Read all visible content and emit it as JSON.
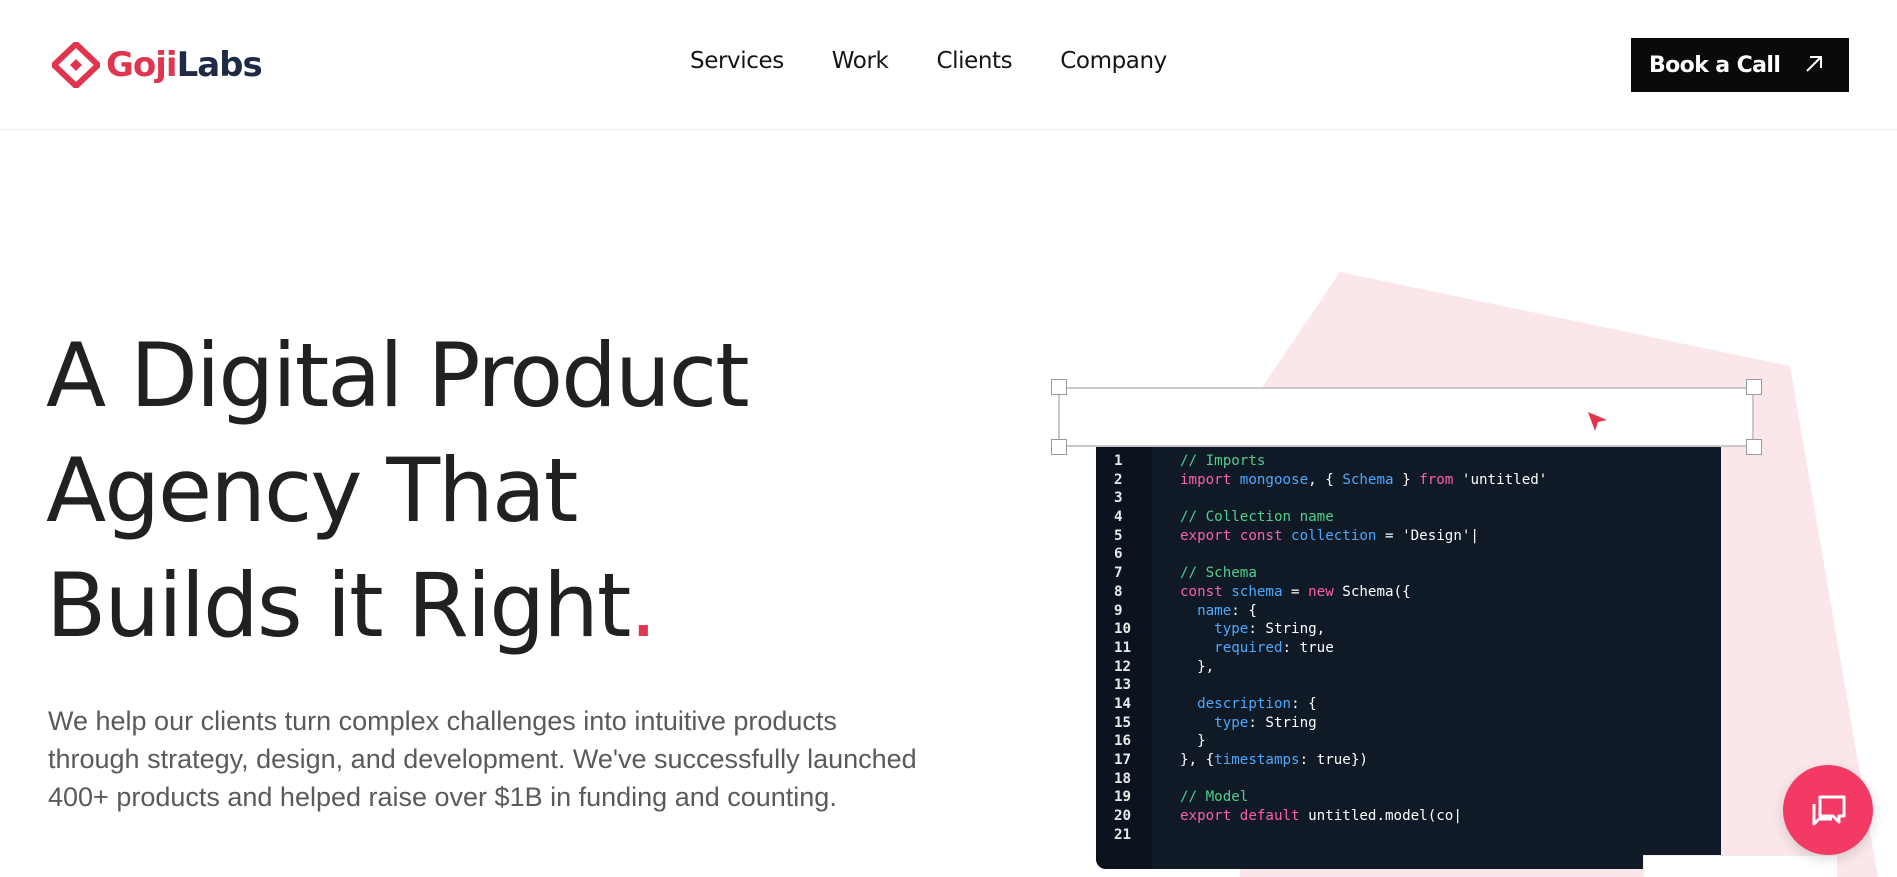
{
  "brand": {
    "name_part1": "Goji",
    "name_part2": "Labs",
    "accent": "#e0344f",
    "navy": "#1f2a44"
  },
  "nav": {
    "items": [
      "Services",
      "Work",
      "Clients",
      "Company"
    ]
  },
  "cta": {
    "label": "Book a Call",
    "icon": "arrow-up-right-icon"
  },
  "hero": {
    "title_line1": "A Digital Product",
    "title_line2": "Agency That",
    "title_line3": "Builds it Right",
    "title_dot": ".",
    "subtitle_line1": "We help our clients turn complex challenges into intuitive products",
    "subtitle_line2": "through strategy, design, and development. We've successfully launched",
    "subtitle_line3": "400+ products and helped raise over $1B in funding and counting."
  },
  "code_editor": {
    "lines": [
      [
        [
          "c",
          "// Imports"
        ]
      ],
      [
        [
          "k",
          "import "
        ],
        [
          "v",
          "mongoose"
        ],
        [
          "s",
          ", { "
        ],
        [
          "v",
          "Schema"
        ],
        [
          "s",
          " } "
        ],
        [
          "k",
          "from "
        ],
        [
          "s",
          "'untitled'"
        ]
      ],
      [],
      [
        [
          "c",
          "// Collection name"
        ]
      ],
      [
        [
          "k",
          "export const "
        ],
        [
          "v",
          "collection"
        ],
        [
          "s",
          " = 'Design'|"
        ]
      ],
      [],
      [
        [
          "c",
          "// Schema"
        ]
      ],
      [
        [
          "k",
          "const "
        ],
        [
          "v",
          "schema"
        ],
        [
          "s",
          " = "
        ],
        [
          "k",
          "new "
        ],
        [
          "s",
          "Schema({"
        ]
      ],
      [
        [
          "s",
          "  "
        ],
        [
          "v",
          "name"
        ],
        [
          "s",
          ": {"
        ]
      ],
      [
        [
          "s",
          "    "
        ],
        [
          "v",
          "type"
        ],
        [
          "s",
          ": String,"
        ]
      ],
      [
        [
          "s",
          "    "
        ],
        [
          "v",
          "required"
        ],
        [
          "s",
          ": true"
        ]
      ],
      [
        [
          "s",
          "  },"
        ]
      ],
      [],
      [
        [
          "s",
          "  "
        ],
        [
          "v",
          "description"
        ],
        [
          "s",
          ": {"
        ]
      ],
      [
        [
          "s",
          "    "
        ],
        [
          "v",
          "type"
        ],
        [
          "s",
          ": String"
        ]
      ],
      [
        [
          "s",
          "  }"
        ]
      ],
      [
        [
          "s",
          "}, {"
        ],
        [
          "v",
          "timestamps"
        ],
        [
          "s",
          ": true})"
        ]
      ],
      [],
      [
        [
          "c",
          "// Model"
        ]
      ],
      [
        [
          "k",
          "export default "
        ],
        [
          "s",
          "untitled.model(co|"
        ]
      ],
      []
    ]
  },
  "chat": {
    "icon": "chat-bubbles-icon",
    "color": "#f23a64"
  }
}
